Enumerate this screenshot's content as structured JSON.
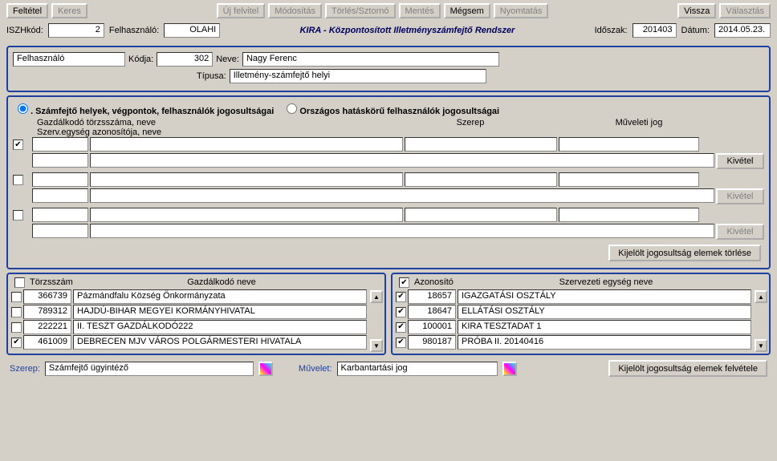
{
  "toolbar": {
    "feltetel": "Feltétel",
    "keres": "Keres",
    "uj_felvitel": "Új felvitel",
    "modositas": "Módosítás",
    "torles": "Törlés/Sztornó",
    "mentes": "Mentés",
    "megsem": "Mégsem",
    "nyomtatas": "Nyomtatás",
    "vissza": "Vissza",
    "valasztas": "Választás"
  },
  "infobar": {
    "iszh_label": "ISZHkód:",
    "iszh_value": "2",
    "user_label": "Felhasználó:",
    "user_value": "OLAHI",
    "title": "KIRA - Központosított Illetményszámfejtő Rendszer",
    "period_label": "Időszak:",
    "period_value": "201403",
    "date_label": "Dátum:",
    "date_value": "2014.05.23."
  },
  "user_panel": {
    "felhasznalo_label": "Felhasználó",
    "kodja_label": "Kódja:",
    "kodja_value": "302",
    "neve_label": "Neve:",
    "neve_value": "Nagy Ferenc",
    "tipusa_label": "Típusa:",
    "tipusa_value": "Illetmény-számfejtő helyi"
  },
  "perms": {
    "radio1": ". Számfejtő helyek, végpontok, felhasználók jogosultságai",
    "radio2": "Országos hatáskörű felhasználók jogosultságai",
    "hdr1a": "Gazdálkodó törzsszáma, neve",
    "hdr1b": "Szerv.egység azonosítója, neve",
    "hdr2": "Szerep",
    "hdr3": "Műveleti jog",
    "kivetel": "Kivétel",
    "delete_btn": "Kijelölt jogosultság elemek törlése"
  },
  "left_list": {
    "hdr1": "Törzsszám",
    "hdr2": "Gazdálkodó neve",
    "rows": [
      {
        "ck": false,
        "a": "366739",
        "b": "Pázmándfalu Község Önkormányzata"
      },
      {
        "ck": false,
        "a": "789312",
        "b": "HAJDÚ-BIHAR MEGYEI KORMÁNYHIVATAL"
      },
      {
        "ck": false,
        "a": "222221",
        "b": "II. TESZT GAZDÁLKODÓ222"
      },
      {
        "ck": true,
        "a": "461009",
        "b": "DEBRECEN MJV VÁROS POLGÁRMESTERI HIVATALA"
      }
    ]
  },
  "right_list": {
    "hdr1": "Azonosító",
    "hdr2": "Szervezeti egység neve",
    "rows": [
      {
        "ck": true,
        "a": "18657",
        "b": "IGAZGATÁSI OSZTÁLY"
      },
      {
        "ck": true,
        "a": "18647",
        "b": "ELLÁTÁSI OSZTÁLY"
      },
      {
        "ck": true,
        "a": "100001",
        "b": "KIRA TESZTADAT 1"
      },
      {
        "ck": true,
        "a": "980187",
        "b": "PRÓBA II. 20140416"
      }
    ]
  },
  "bottom": {
    "szerep_label": "Szerep:",
    "szerep_value": "Számfejtő ügyintéző",
    "muvelet_label": "Művelet:",
    "muvelet_value": "Karbantartási jog",
    "add_btn": "Kijelölt jogosultság elemek felvétele"
  }
}
